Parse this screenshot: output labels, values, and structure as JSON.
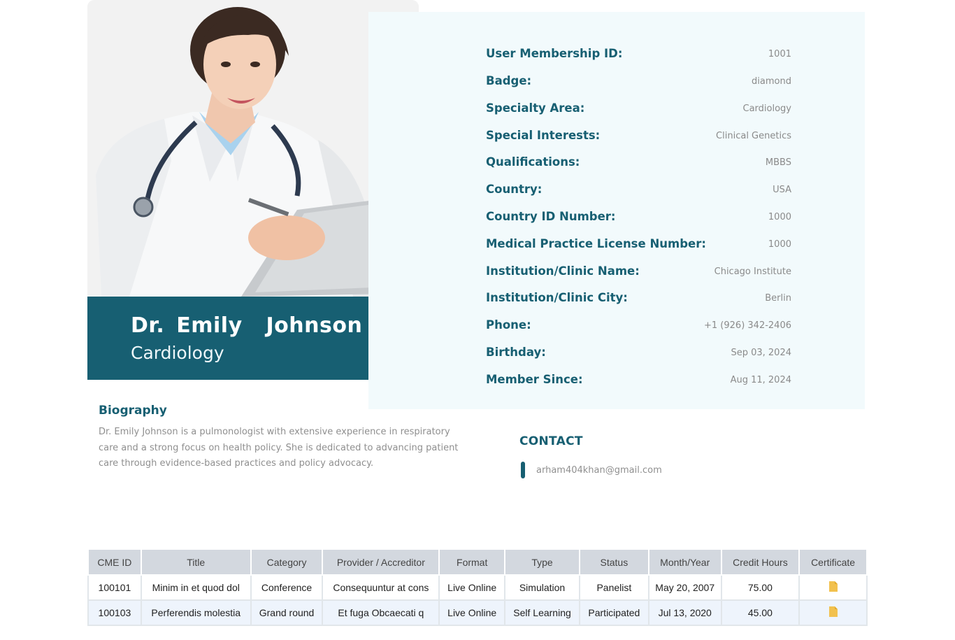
{
  "profile": {
    "name": "Dr. Emily  Johnson",
    "specialty": "Cardiology",
    "photo_alt": "doctor-portrait"
  },
  "info": [
    {
      "label": "User Membership ID:",
      "value": "1001"
    },
    {
      "label": "Badge:",
      "value": "diamond"
    },
    {
      "label": "Specialty Area:",
      "value": "Cardiology"
    },
    {
      "label": "Special Interests:",
      "value": "Clinical Genetics"
    },
    {
      "label": "Qualifications:",
      "value": "MBBS"
    },
    {
      "label": "Country:",
      "value": "USA"
    },
    {
      "label": "Country ID Number:",
      "value": "1000"
    },
    {
      "label": "Medical Practice License Number:",
      "value": "1000"
    },
    {
      "label": "Institution/Clinic Name:",
      "value": "Chicago Institute"
    },
    {
      "label": "Institution/Clinic City:",
      "value": "Berlin"
    },
    {
      "label": "Phone:",
      "value": "+1 (926) 342-2406"
    },
    {
      "label": "Birthday:",
      "value": "Sep 03, 2024"
    },
    {
      "label": "Member Since:",
      "value": "Aug 11, 2024"
    }
  ],
  "biography": {
    "title": "Biography",
    "text": "Dr. Emily Johnson is a pulmonologist with extensive experience in respiratory care and a strong focus on health policy. She is dedicated to advancing patient care through evidence-based practices and policy advocacy."
  },
  "contact": {
    "title": "CONTACT",
    "email": "arham404khan@gmail.com"
  },
  "table": {
    "headers": [
      "CME ID",
      "Title",
      "Category",
      "Provider / Accreditor",
      "Format",
      "Type",
      "Status",
      "Month/Year",
      "Credit Hours",
      "Certificate"
    ],
    "rows": [
      [
        "100101",
        "Minim in et quod dol",
        "Conference",
        "Consequuntur at cons",
        "Live Online",
        "Simulation",
        "Panelist",
        "May 20, 2007",
        "75.00"
      ],
      [
        "100103",
        "Perferendis molestia",
        "Grand round",
        "Et fuga Obcaecati q",
        "Live Online",
        "Self Learning",
        "Participated",
        "Jul 13, 2020",
        "45.00"
      ]
    ]
  },
  "colors": {
    "primary": "#175f72",
    "panel": "#f2fafc",
    "header": "#d3d8df",
    "certificate": "#f2c14e"
  }
}
